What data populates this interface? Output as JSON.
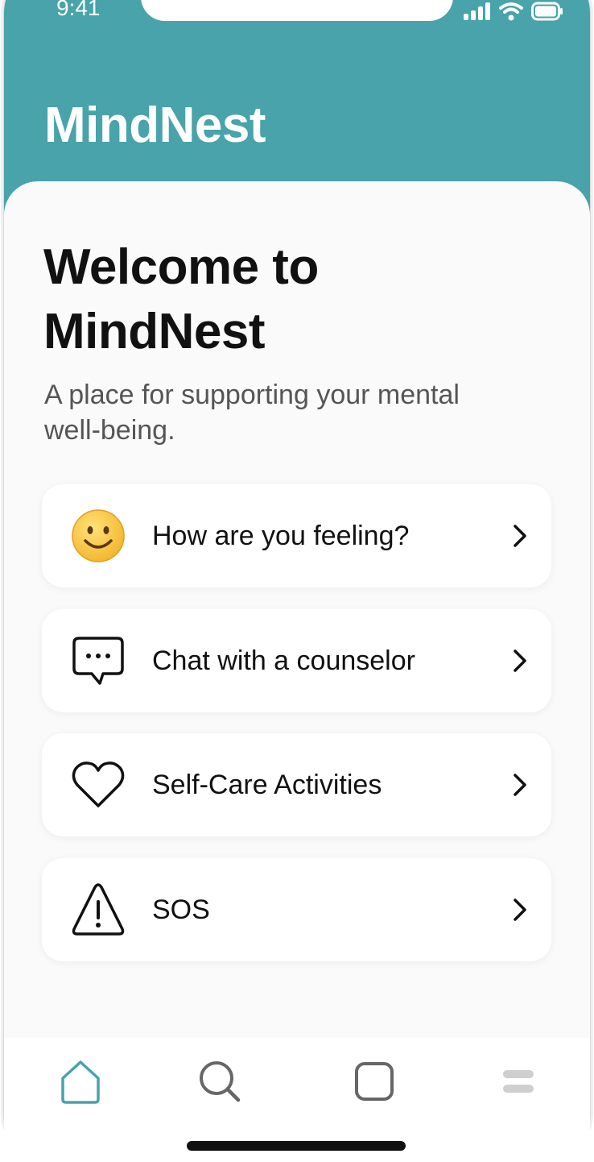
{
  "status_bar": {
    "time": "9:41",
    "icons": [
      "cellular-signal-icon",
      "wifi-icon",
      "battery-icon"
    ]
  },
  "header": {
    "app_title": "MindNest",
    "background_color": "#48a3aa"
  },
  "main": {
    "welcome_title": "Welcome to MindNest",
    "subtitle": "A place for supporting your mental well-being."
  },
  "menu": {
    "items": [
      {
        "label": "How are you feeling?",
        "icon": "smiley-face-icon"
      },
      {
        "label": "Chat with a counselor",
        "icon": "chat-bubble-icon"
      },
      {
        "label": "Self-Care Activities",
        "icon": "heart-icon"
      },
      {
        "label": "SOS",
        "icon": "warning-triangle-icon"
      }
    ]
  },
  "tab_bar": {
    "items": [
      {
        "icon": "home-icon",
        "active": true
      },
      {
        "icon": "search-icon",
        "active": false
      },
      {
        "icon": "square-icon",
        "active": false
      },
      {
        "icon": "menu-icon",
        "active": false
      }
    ],
    "active_color": "#48a3aa",
    "inactive_color": "#666666"
  }
}
